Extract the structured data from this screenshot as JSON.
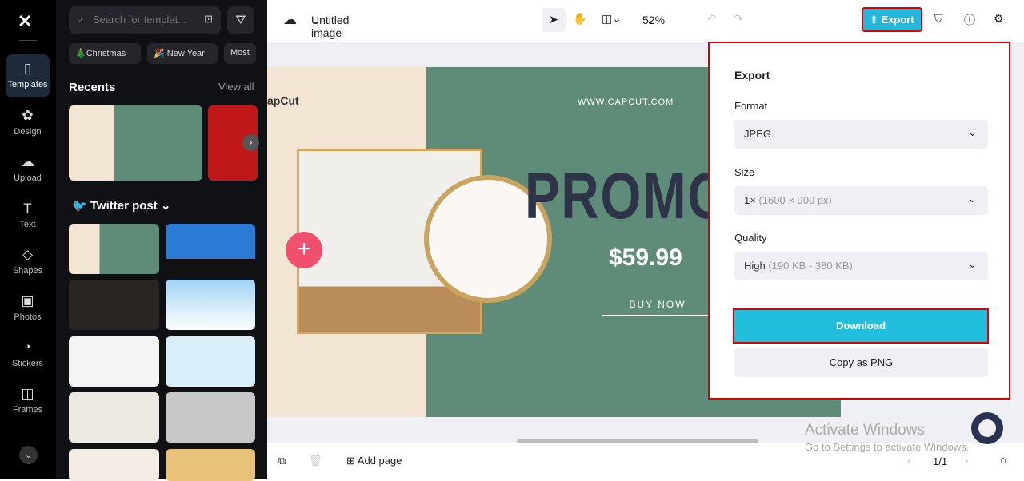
{
  "rail": {
    "items": [
      {
        "label": "Templates",
        "icon": "templates-icon"
      },
      {
        "label": "Design",
        "icon": "design-icon"
      },
      {
        "label": "Upload",
        "icon": "upload-icon"
      },
      {
        "label": "Text",
        "icon": "text-icon"
      },
      {
        "label": "Shapes",
        "icon": "shapes-icon"
      },
      {
        "label": "Photos",
        "icon": "photos-icon"
      },
      {
        "label": "Stickers",
        "icon": "stickers-icon"
      },
      {
        "label": "Frames",
        "icon": "frames-icon"
      }
    ]
  },
  "panel": {
    "search_placeholder": "Search for templat...",
    "chips": [
      "🎄Christmas",
      "🎉 New Year",
      "Most"
    ],
    "recents": "Recents",
    "view_all": "View all",
    "section": "Twitter post"
  },
  "top": {
    "title": "Untitled image",
    "zoom": "52%",
    "export": "Export"
  },
  "design": {
    "brand": "apCut",
    "url": "WWW.CAPCUT.COM",
    "headline": "PROMOT",
    "price": "$59.99",
    "cta": "BUY NOW"
  },
  "export": {
    "title": "Export",
    "format_label": "Format",
    "format": "JPEG",
    "size_label": "Size",
    "size": "1×",
    "size_detail": "(1600 × 900 px)",
    "quality_label": "Quality",
    "quality": "High",
    "quality_detail": "(190 KB - 380 KB)",
    "download": "Download",
    "copy": "Copy as PNG"
  },
  "bottom": {
    "add_page": "Add page",
    "page": "1/1"
  },
  "watermark": {
    "line1": "Activate Windows",
    "line2": "Go to Settings to activate Windows."
  },
  "colors": {
    "accent": "#22b8dc",
    "highlight": "#dd0000",
    "design_green": "#5f8b79"
  }
}
